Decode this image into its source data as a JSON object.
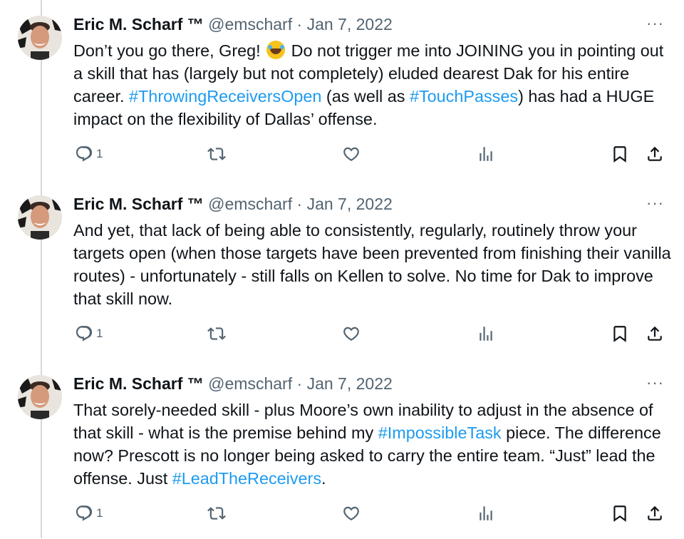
{
  "tweets": [
    {
      "author_name": "Eric M. Scharf ™",
      "handle": "@emscharf",
      "separator": "·",
      "date": "Jan 7, 2022",
      "more_label": "···",
      "text_1": "Don’t you go there, Greg! ",
      "emoji_name": "rolling-on-floor-laughing-emoji",
      "text_2": " Do not trigger me into JOINING you in pointing out a skill that has (largely but not completely) eluded dearest Dak for his entire career. ",
      "hashtag_1": "#ThrowingReceiversOpen",
      "text_3": " (as well as ",
      "hashtag_2": "#TouchPasses",
      "text_4": ") has had a HUGE impact on the flexibility of Dallas’ offense.",
      "reply_count": "1"
    },
    {
      "author_name": "Eric M. Scharf ™",
      "handle": "@emscharf",
      "separator": "·",
      "date": "Jan 7, 2022",
      "more_label": "···",
      "text_1": "And yet, that lack of being able to consistently, regularly, routinely throw your targets open (when those targets have been prevented from finishing their vanilla routes) - unfortunately - still falls on Kellen to solve. No time for Dak to improve that skill now.",
      "reply_count": "1"
    },
    {
      "author_name": "Eric M. Scharf ™",
      "handle": "@emscharf",
      "separator": "·",
      "date": "Jan 7, 2022",
      "more_label": "···",
      "text_1": "That sorely-needed skill - plus Moore’s own inability to adjust in the absence of that skill - what is the premise behind my ",
      "hashtag_1": "#ImpossibleTask",
      "text_2": " piece. The difference now? Prescott is no longer being asked to carry the entire team. “Just” lead the offense. Just ",
      "hashtag_2": "#LeadTheReceivers",
      "text_3": ".",
      "reply_count": "1"
    }
  ],
  "icons": [
    "reply-icon",
    "retweet-icon",
    "like-icon",
    "views-icon",
    "bookmark-icon",
    "share-icon"
  ],
  "colors": {
    "link": "#1d9bf0",
    "muted": "#536471",
    "text": "#0f1419",
    "thread_line": "#cfd9de"
  }
}
